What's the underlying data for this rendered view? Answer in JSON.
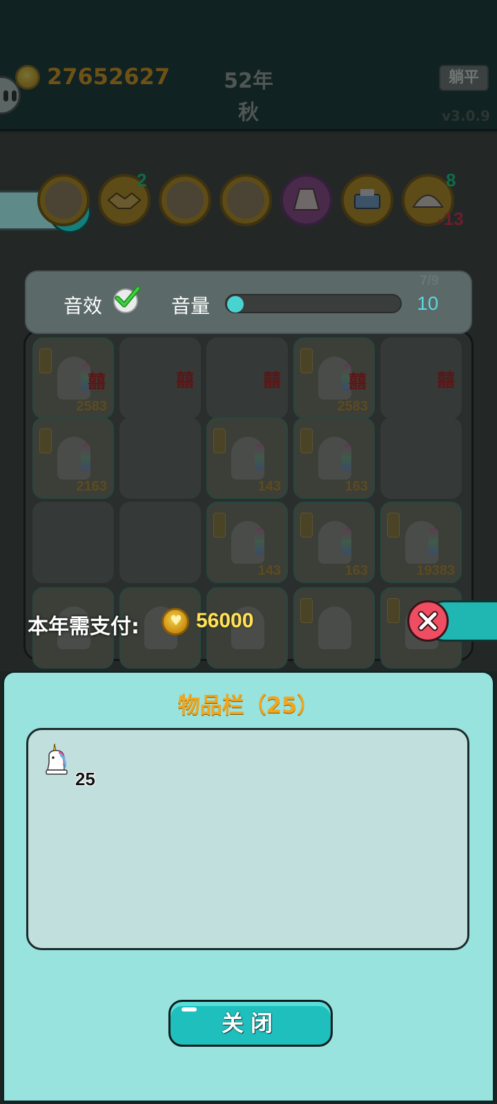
{
  "header": {
    "money": "27652627",
    "year": "52年",
    "season": "秋",
    "flat_button": "躺平",
    "version": "v3.0.9"
  },
  "shop_badges": {
    "handshake_count": "2",
    "shell_count": "8",
    "shell_delta": "-13"
  },
  "board": {
    "cell_numbers": [
      "2583",
      "2583",
      "2163",
      "143",
      "163",
      "143",
      "163",
      "19383"
    ]
  },
  "settings": {
    "sfx_label": "音效",
    "sfx_enabled": true,
    "volume_label": "音量",
    "volume_value": "10",
    "volume_fraction": 0.0,
    "page_indicator": "7/9"
  },
  "payment": {
    "label": "本年需支付:",
    "amount": "56000"
  },
  "inventory": {
    "title": "物品栏（25）",
    "items": [
      {
        "icon": "unicorn-icon",
        "count": "25"
      }
    ],
    "close_label": "关闭"
  },
  "colors": {
    "accent": "#1fbfbd",
    "panel": "#99e3df",
    "gold": "#f0a71e",
    "close_red": "#ee4d62"
  }
}
